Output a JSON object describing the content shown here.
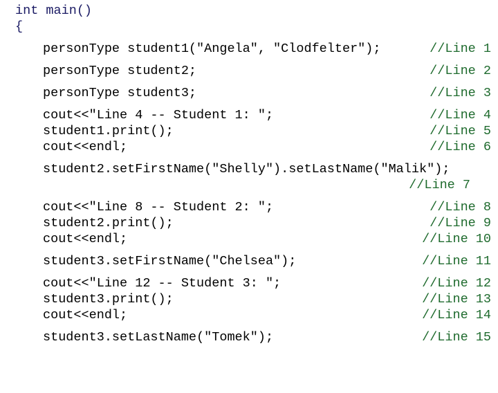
{
  "slide": {
    "title": "C++ code listing - main function with personType objects",
    "background_color": "#ffffff",
    "code_color": "#000000",
    "keyword_color": "#1b1b64",
    "comment_color": "#1f6b2e"
  },
  "code": {
    "header_line_1": "int main()",
    "header_line_2": "{",
    "lines": [
      {
        "code": "personType student1(\"Angela\", \"Clodfelter\");",
        "comment": "//Line 1"
      },
      {
        "code": "personType student2;",
        "comment": "//Line 2"
      },
      {
        "code": "personType student3;",
        "comment": "//Line 3"
      },
      {
        "code": "cout<<\"Line 4 -- Student 1: \";",
        "comment": "//Line 4"
      },
      {
        "code": "student1.print();",
        "comment": "//Line 5"
      },
      {
        "code": "cout<<endl;",
        "comment": "//Line 6"
      },
      {
        "code": "student2.setFirstName(\"Shelly\").setLastName(\"Malik\");",
        "comment": "//Line 7"
      },
      {
        "code": "cout<<\"Line 8 -- Student 2: \";",
        "comment": "//Line 8"
      },
      {
        "code": "student2.print();",
        "comment": "//Line 9"
      },
      {
        "code": "cout<<endl;",
        "comment": "//Line 10"
      },
      {
        "code": "student3.setFirstName(\"Chelsea\");",
        "comment": "//Line 11"
      },
      {
        "code": "cout<<\"Line 12 -- Student 3: \";",
        "comment": "//Line 12"
      },
      {
        "code": "student3.print();",
        "comment": "//Line 13"
      },
      {
        "code": "cout<<endl;",
        "comment": "//Line 14"
      },
      {
        "code": "student3.setLastName(\"Tomek\");",
        "comment": "//Line 15"
      }
    ]
  }
}
